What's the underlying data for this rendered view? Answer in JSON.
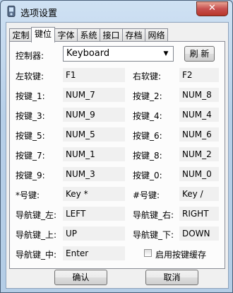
{
  "window": {
    "title": "选项设置",
    "close_label": "✕"
  },
  "tabs": [
    "定制",
    "键位",
    "字体",
    "系统",
    "接口",
    "存档",
    "网络"
  ],
  "active_tab": "键位",
  "controller": {
    "label": "控制器:",
    "value": "Keyboard",
    "refresh_label": "刷 新"
  },
  "keys": [
    {
      "left_label": "左软键:",
      "left_value": "F1",
      "right_label": "右软键:",
      "right_value": "F2"
    },
    {
      "left_label": "按键_1:",
      "left_value": "NUM_7",
      "right_label": "按键_2:",
      "right_value": "NUM_8"
    },
    {
      "left_label": "按键_3:",
      "left_value": "NUM_9",
      "right_label": "按键_4:",
      "right_value": "NUM_4"
    },
    {
      "left_label": "按键_5:",
      "left_value": "NUM_5",
      "right_label": "按键_6:",
      "right_value": "NUM_6"
    },
    {
      "left_label": "按键_7:",
      "left_value": "NUM_1",
      "right_label": "按键_8:",
      "right_value": "NUM_2"
    },
    {
      "left_label": "按键_9:",
      "left_value": "NUM_3",
      "right_label": "按键_0:",
      "right_value": "NUM_0"
    },
    {
      "left_label": "*号键:",
      "left_value": "Key *",
      "right_label": "#号键:",
      "right_value": "Key /"
    },
    {
      "left_label": "导航键_左:",
      "left_value": "LEFT",
      "right_label": "导航键_右:",
      "right_value": "RIGHT"
    },
    {
      "left_label": "导航键_上:",
      "left_value": "UP",
      "right_label": "导航键_下:",
      "right_value": "DOWN"
    }
  ],
  "nav_center": {
    "label": "导航键_中:",
    "value": "Enter"
  },
  "cache_checkbox": {
    "label": "启用按键缓存",
    "checked": false
  },
  "buttons": {
    "ok": "确认",
    "cancel": "取消"
  }
}
